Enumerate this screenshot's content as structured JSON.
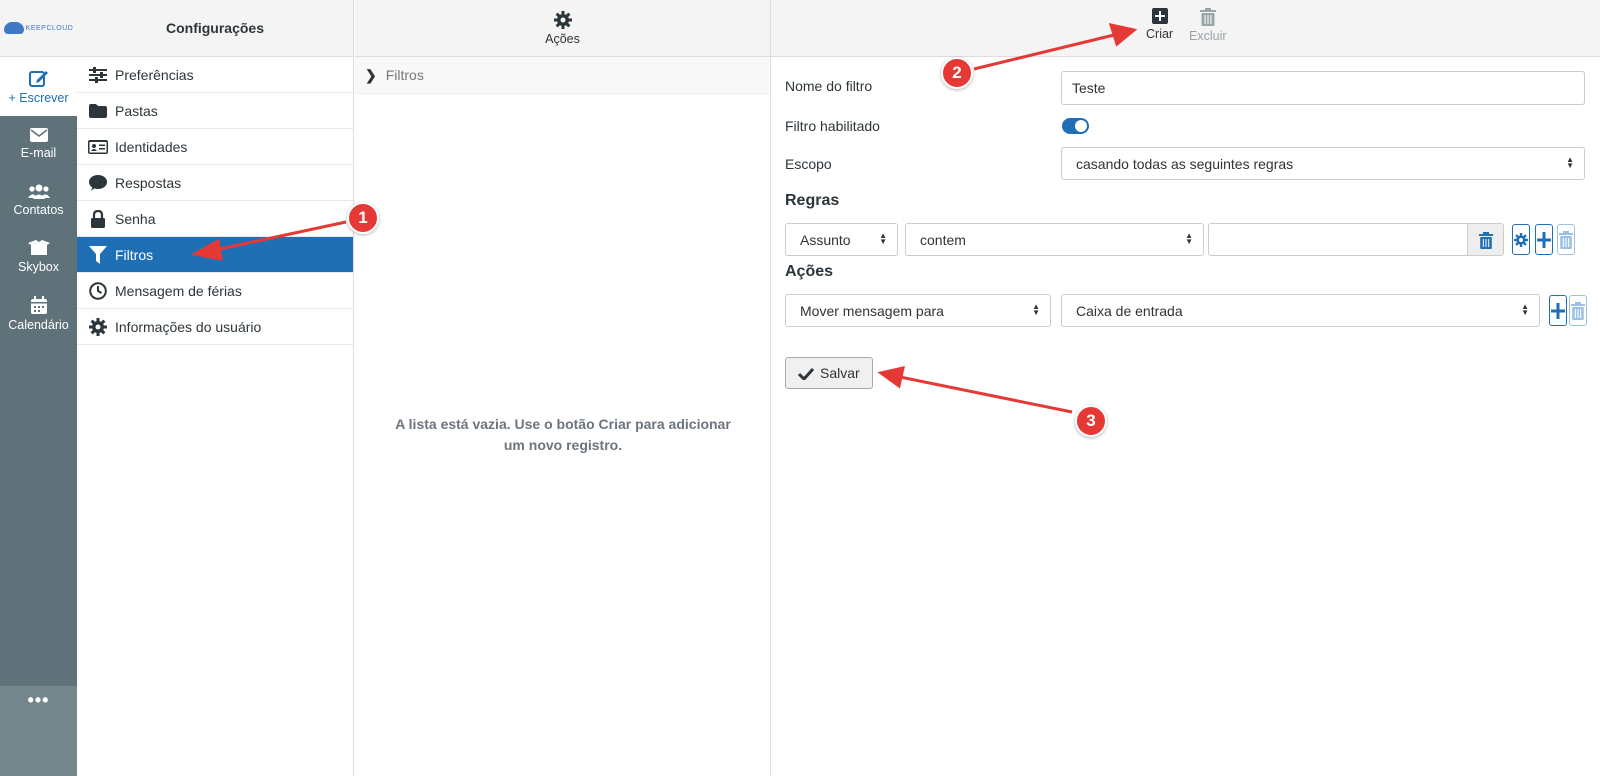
{
  "rail": {
    "logo_text": "KEEPCLOUD",
    "compose_label": "+ Escrever",
    "items": [
      {
        "label": "E-mail",
        "icon": "envelope-icon"
      },
      {
        "label": "Contatos",
        "icon": "users-icon"
      },
      {
        "label": "Skybox",
        "icon": "box-icon"
      },
      {
        "label": "Calendário",
        "icon": "calendar-icon"
      }
    ],
    "more_label": "•••"
  },
  "settings": {
    "title": "Configurações",
    "items": [
      {
        "label": "Preferências",
        "icon": "sliders-icon"
      },
      {
        "label": "Pastas",
        "icon": "folder-icon"
      },
      {
        "label": "Identidades",
        "icon": "id-card-icon"
      },
      {
        "label": "Respostas",
        "icon": "comment-icon"
      },
      {
        "label": "Senha",
        "icon": "lock-icon"
      },
      {
        "label": "Filtros",
        "icon": "filter-icon",
        "active": true
      },
      {
        "label": "Mensagem de férias",
        "icon": "clock-icon"
      },
      {
        "label": "Informações do usuário",
        "icon": "gear-icon"
      }
    ]
  },
  "filters_panel": {
    "actions_label": "Ações",
    "breadcrumb": "Filtros",
    "empty_message": "A lista está vazia. Use o botão Criar para adicionar um novo registro."
  },
  "toolbar": {
    "create_label": "Criar",
    "delete_label": "Excluir"
  },
  "form": {
    "name_label": "Nome do filtro",
    "name_value": "Teste",
    "enabled_label": "Filtro habilitado",
    "enabled": true,
    "scope_label": "Escopo",
    "scope_value": "casando todas as seguintes regras",
    "rules_title": "Regras",
    "rule": {
      "header": "Assunto",
      "operator": "contem",
      "value": ""
    },
    "actions_title": "Ações",
    "action": {
      "type": "Mover mensagem para",
      "target": "Caixa de entrada"
    },
    "save_label": "Salvar"
  },
  "annotations": [
    {
      "number": "1"
    },
    {
      "number": "2"
    },
    {
      "number": "3"
    }
  ],
  "colors": {
    "accent": "#1f6fb5",
    "rail": "#5f7279",
    "annotation": "#e53935"
  }
}
